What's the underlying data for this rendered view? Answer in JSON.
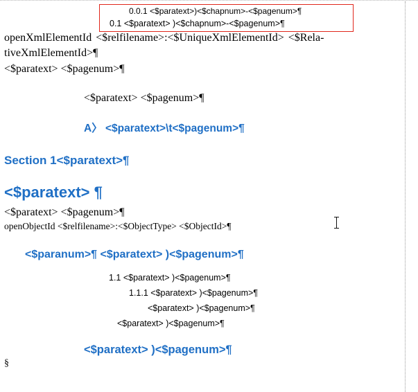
{
  "document": {
    "lines": [
      {
        "id": "toc-001",
        "text": "0.0.1 <$paratext>)<$chapnum>-<$pagenum>¶"
      },
      {
        "id": "toc-01",
        "text": "0.1 <$paratext> )<$chapnum>-<$pagenum>¶"
      },
      {
        "id": "open-xml",
        "text": "openXmlElementId   <$relfilename>:<$UniqueXmlElementId>   <$Rela-"
      },
      {
        "id": "open-xml-cont",
        "text": "tiveXmlElementId>¶"
      },
      {
        "id": "paratext-pagenum-1",
        "text": "<$paratext> <$pagenum>¶"
      },
      {
        "id": "paratext-pagenum-2",
        "text": "<$paratext> <$pagenum>¶"
      },
      {
        "id": "heading-a",
        "text": "A〉 <$paratext>\\t<$pagenum>¶"
      },
      {
        "id": "section-heading",
        "text": "Section 1<$paratext>¶"
      },
      {
        "id": "large-heading",
        "text": "<$paratext> ¶"
      },
      {
        "id": "paratext-pagenum-3",
        "text": "<$paratext> <$pagenum>¶"
      },
      {
        "id": "open-object",
        "text": "openObjectId <$relfilename>:<$ObjectType> <$ObjectId>¶"
      },
      {
        "id": "paranum-heading",
        "text": "<$paranum>¶ <$paratext> )<$pagenum>¶"
      },
      {
        "id": "toc-1-1",
        "text": "1.1 <$paratext> )<$pagenum>¶"
      },
      {
        "id": "toc-1-1-1",
        "text": "1.1.1 <$paratext> )<$pagenum>¶"
      },
      {
        "id": "toc-l4",
        "text": "<$paratext> )<$pagenum>¶"
      },
      {
        "id": "toc-l5",
        "text": "<$paratext> )<$pagenum>¶"
      },
      {
        "id": "bottom-heading",
        "text": "<$paratext> )<$pagenum>¶"
      },
      {
        "id": "section-mark",
        "text": "§"
      }
    ]
  },
  "colors": {
    "heading_blue": "#1f6fc5",
    "selection_border": "#e0261b",
    "spell_squiggle": "#e01b1b"
  },
  "icons": {
    "cursor": "i-beam-cursor-icon"
  }
}
